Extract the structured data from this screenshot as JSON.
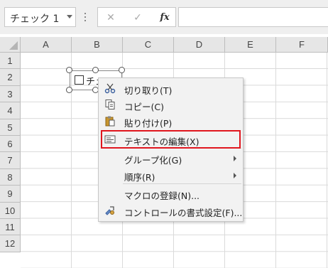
{
  "formula_bar": {
    "name_box": "チェック 1",
    "cancel_glyph": "✕",
    "enter_glyph": "✓",
    "fx_label": "fx",
    "formula_value": ""
  },
  "columns": [
    "A",
    "B",
    "C",
    "D",
    "E",
    "F"
  ],
  "rows": [
    "1",
    "2",
    "3",
    "4",
    "5",
    "6",
    "7",
    "8",
    "9",
    "10",
    "11",
    "12"
  ],
  "checkbox": {
    "label": "チェッ",
    "checked": false
  },
  "context_menu": {
    "items": [
      {
        "label": "切り取り(T)",
        "icon": "scissors-icon"
      },
      {
        "label": "コピー(C)",
        "icon": "copy-icon"
      },
      {
        "label": "貼り付け(P)",
        "icon": "paste-icon"
      },
      {
        "label": "テキストの編集(X)",
        "icon": "edit-text-icon",
        "highlighted": true
      },
      {
        "label": "グループ化(G)",
        "icon": "",
        "submenu": true
      },
      {
        "label": "順序(R)",
        "icon": "",
        "submenu": true
      },
      {
        "label": "マクロの登録(N)...",
        "icon": ""
      },
      {
        "label": "コントロールの書式設定(F)...",
        "icon": "format-control-icon"
      }
    ]
  },
  "colors": {
    "highlight_border": "#e0161e",
    "menu_bg": "#f2f2f2",
    "header_bg": "#e6e6e6"
  }
}
